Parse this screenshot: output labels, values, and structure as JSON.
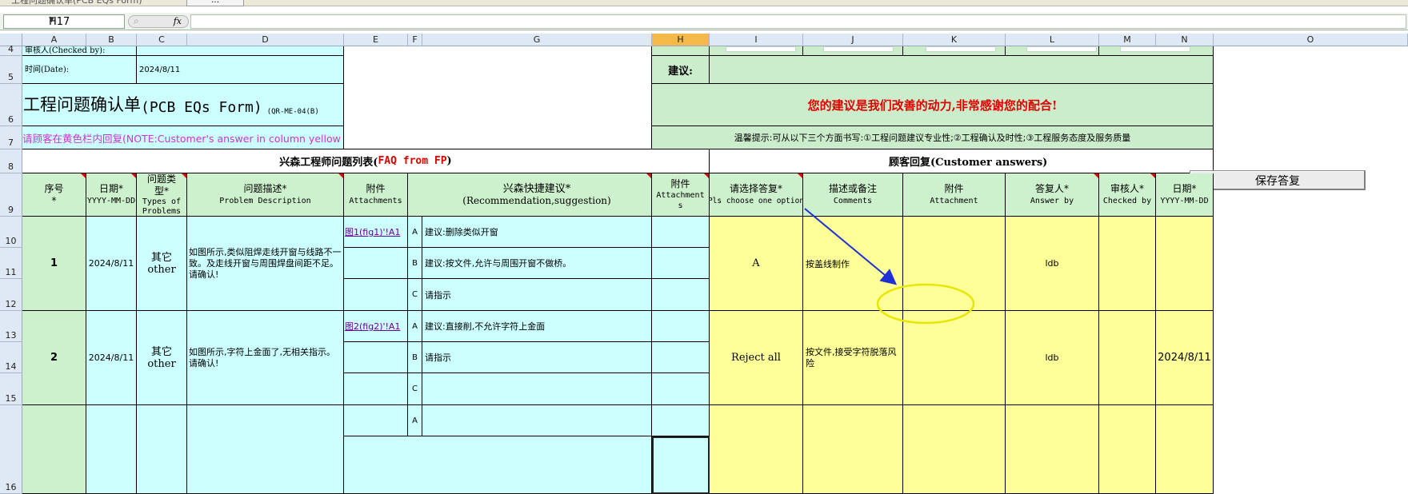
{
  "window": {
    "title_fragment": "工程问题确认单(PCB EQs Form)",
    "title_button": "…"
  },
  "formula_bar": {
    "name_box": "H17",
    "fx_label": "fx",
    "zoom_glyph": "⌕",
    "formula": ""
  },
  "columns": [
    "A",
    "B",
    "C",
    "D",
    "E",
    "F",
    "G",
    "H",
    "I",
    "J",
    "K",
    "L",
    "M",
    "N",
    "O"
  ],
  "selected_column": "H",
  "rows": [
    "4",
    "5",
    "6",
    "7",
    "8",
    "9",
    "10",
    "11",
    "12",
    "13",
    "14",
    "15",
    "16"
  ],
  "form": {
    "checked_by_label": "审核人(Checked by):",
    "date_label": "时间(Date):",
    "date_value": "2024/8/11",
    "title_cn": "工程问题确认单",
    "title_en": "(PCB EQs Form)",
    "form_code": "(QR-ME-04(B)",
    "yellow_note": "请顾客在黄色栏内回复(NOTE:Customer's answer in column yellow area)",
    "suggestion_label": "建议:",
    "thanks": "您的建议是我们改善的动力,非常感谢您的配合!",
    "tip": "温馨提示:可从以下三个方面书写:①工程问题建议专业性;②工程确认及时性;③工程服务态度及服务质量",
    "faq_title_cn": "兴森工程师问题列表(",
    "faq_title_en": "FAQ from FP",
    "faq_title_end": ")",
    "customer_title": "顾客回复(Customer answers)",
    "save_button": "保存答复"
  },
  "headers": {
    "seq": {
      "cn": "序号",
      "en": "*"
    },
    "date": {
      "cn": "日期*",
      "en": "YYYY-MM-DD"
    },
    "type": {
      "cn": "问题类型*",
      "en": "Types of Problems"
    },
    "desc": {
      "cn": "问题描述*",
      "en": "Problem Description"
    },
    "attach": {
      "cn": "附件",
      "en": "Attachments"
    },
    "recommend": {
      "cn": "兴森快捷建议*",
      "en": "(Recommendation,suggestion)"
    },
    "attach2": {
      "cn": "附件",
      "en": "Attachments"
    },
    "choose": {
      "cn": "请选择答复*",
      "en": "Pls choose one option"
    },
    "comments": {
      "cn": "描述或备注",
      "en": "Comments"
    },
    "attach3": {
      "cn": "附件",
      "en": "Attachment"
    },
    "answer_by": {
      "cn": "答复人*",
      "en": "Answer by"
    },
    "checked_by": {
      "cn": "审核人*",
      "en": "Checked by"
    },
    "date2": {
      "cn": "日期*",
      "en": "YYYY-MM-DD"
    }
  },
  "problems": [
    {
      "seq": "1",
      "date": "2024/8/11",
      "type_cn": "其它",
      "type_en": "other",
      "desc": "如图所示,类似阻焊走线开窗与线路不一致。及走线开窗与周围焊盘间距不足。请确认!",
      "link": "图1(fig1)'!A1",
      "options": [
        {
          "key": "A",
          "text": "建议:删除类似开窗"
        },
        {
          "key": "B",
          "text": "建议:按文件,允许与周围开窗不做桥。"
        },
        {
          "key": "C",
          "text": "请指示"
        }
      ],
      "answer": "A",
      "comment": "按盖线制作",
      "answer_by": "ldb",
      "answer_date": ""
    },
    {
      "seq": "2",
      "date": "2024/8/11",
      "type_cn": "其它",
      "type_en": "other",
      "desc": "如图所示,字符上金面了,无相关指示。请确认!",
      "link": "图2(fig2)'!A1",
      "options": [
        {
          "key": "A",
          "text": "建议:直接削,不允许字符上金面"
        },
        {
          "key": "B",
          "text": "请指示"
        },
        {
          "key": "C",
          "text": ""
        }
      ],
      "answer": "Reject all",
      "comment": "按文件,接受字符脱落风险",
      "answer_by": "ldb",
      "answer_date": "2024/8/11"
    },
    {
      "options": [
        {
          "key": "A",
          "text": ""
        }
      ]
    }
  ]
}
